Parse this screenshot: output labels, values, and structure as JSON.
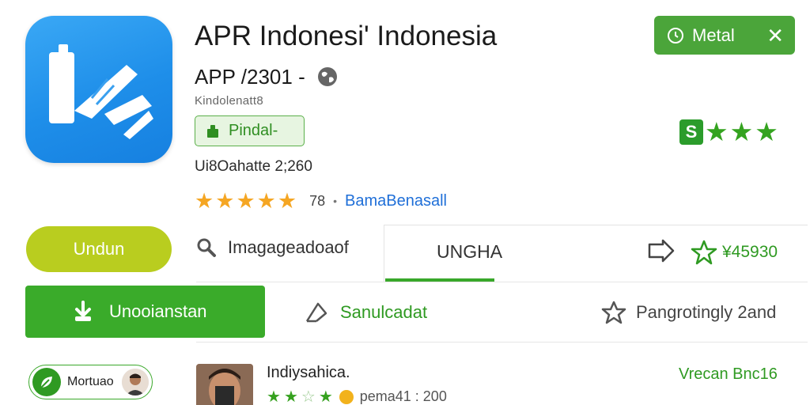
{
  "app": {
    "title": "APR Indonesi' Indonesia",
    "subtitle": "APP /2301 -",
    "developer": "Kindolenatt8",
    "category": "Pindal-",
    "updated": "Ui8Oahatte 2;260",
    "rating_count": "78",
    "rating_link": "BamaBenasall",
    "rating_stars": 5
  },
  "top_right": {
    "metal_label": "Metal",
    "green_stars": 3
  },
  "actions": {
    "undun_label": "Undun",
    "search_label": "Imagageadoaof",
    "tab_label": "UNGHA",
    "price_label": "¥45930",
    "install_label": "Unooianstan",
    "sample_label": "Sanulcadat",
    "wishlist_label": "Pangrotingly 2and"
  },
  "review": {
    "chip_label": "Mortuao",
    "reviewer_name": "Indiysahica.",
    "meta_text": "pema41 : 200",
    "date": "Vrecan Bnc16"
  },
  "colors": {
    "brand_green": "#3aab2a",
    "icon_blue": "#1e8ee9",
    "undun_lime": "#b9cd1f",
    "link_blue": "#1f6fd8"
  }
}
